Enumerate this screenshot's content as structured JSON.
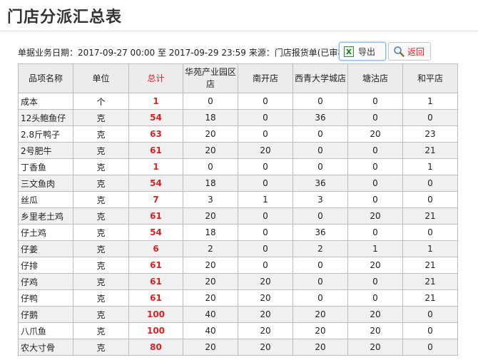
{
  "page": {
    "title": "门店分派汇总表"
  },
  "info": {
    "text": "单据业务日期：2017-09-27 00:00 至 2017-09-29 23:59 来源：门店报货单(已审核)"
  },
  "buttons": {
    "export_label": "导出",
    "export_icon": "excel-icon",
    "back_label": "返回",
    "back_icon": "search-icon"
  },
  "colors": {
    "accent_red": "#e02020",
    "header_bg": "#ececec",
    "alt_row_bg": "#f0f0f0"
  },
  "table": {
    "headers": [
      "品项名称",
      "单位",
      "总计",
      "华苑产业园区店",
      "南开店",
      "西青大学城店",
      "塘沽店",
      "和平店"
    ],
    "rows": [
      [
        "成本",
        "个",
        "1",
        "0",
        "0",
        "0",
        "0",
        "1"
      ],
      [
        "12头鲍鱼仔",
        "克",
        "54",
        "18",
        "0",
        "36",
        "0",
        "0"
      ],
      [
        "2.8斤鸭子",
        "克",
        "63",
        "20",
        "0",
        "0",
        "20",
        "23"
      ],
      [
        "2号肥牛",
        "克",
        "61",
        "20",
        "20",
        "0",
        "0",
        "21"
      ],
      [
        "丁香鱼",
        "克",
        "1",
        "0",
        "0",
        "0",
        "0",
        "1"
      ],
      [
        "三文鱼肉",
        "克",
        "54",
        "18",
        "0",
        "36",
        "0",
        "0"
      ],
      [
        "丝瓜",
        "克",
        "7",
        "3",
        "1",
        "3",
        "0",
        "0"
      ],
      [
        "乡里老土鸡",
        "克",
        "61",
        "20",
        "0",
        "0",
        "20",
        "21"
      ],
      [
        "仔土鸡",
        "克",
        "54",
        "18",
        "0",
        "36",
        "0",
        "0"
      ],
      [
        "仔姜",
        "克",
        "6",
        "2",
        "0",
        "2",
        "1",
        "1"
      ],
      [
        "仔排",
        "克",
        "61",
        "20",
        "0",
        "0",
        "20",
        "21"
      ],
      [
        "仔鸡",
        "克",
        "61",
        "20",
        "20",
        "0",
        "0",
        "21"
      ],
      [
        "仔鸭",
        "克",
        "61",
        "20",
        "20",
        "0",
        "0",
        "21"
      ],
      [
        "仔鹅",
        "克",
        "100",
        "40",
        "20",
        "20",
        "20",
        "0"
      ],
      [
        "八爪鱼",
        "克",
        "100",
        "40",
        "20",
        "20",
        "20",
        "0"
      ],
      [
        "农大寸骨",
        "克",
        "80",
        "20",
        "20",
        "20",
        "20",
        "0"
      ]
    ]
  }
}
